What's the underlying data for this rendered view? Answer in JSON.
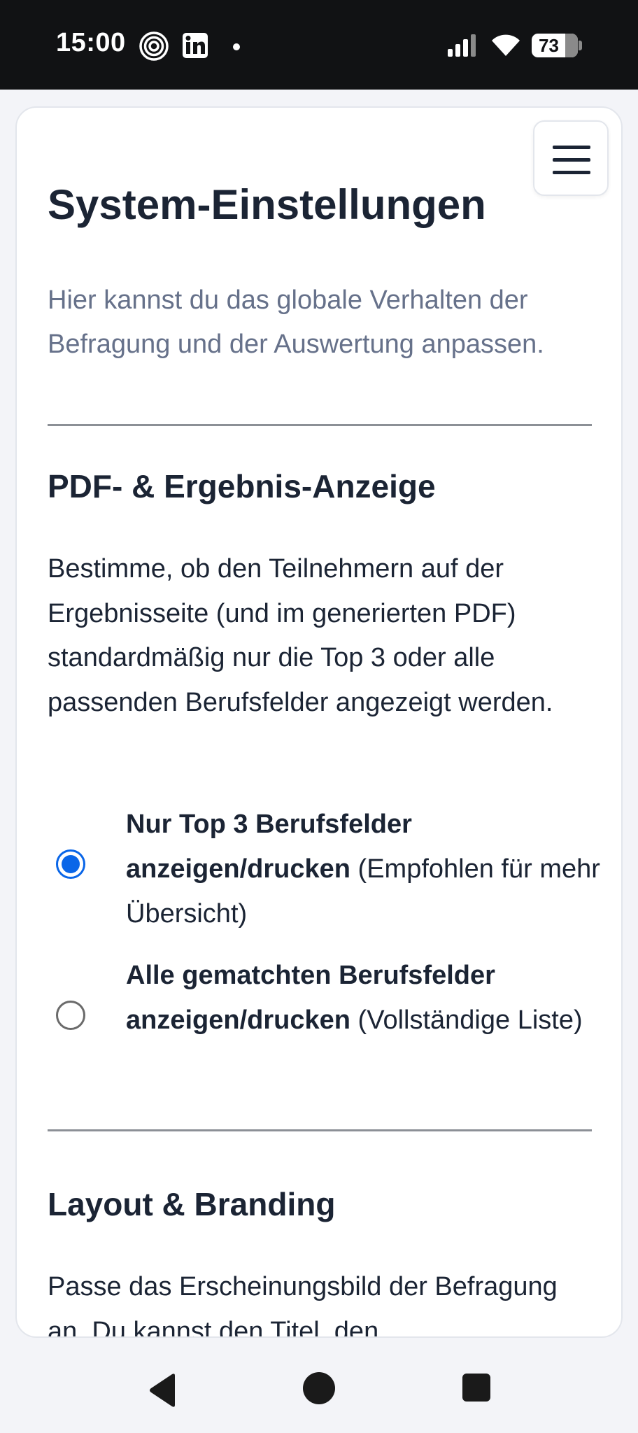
{
  "status_bar": {
    "time": "15:00",
    "battery": "73",
    "icons": [
      "fingerprint-icon",
      "linkedin-icon",
      "dot-icon",
      "signal-icon",
      "wifi-icon",
      "battery-icon"
    ]
  },
  "page": {
    "title": "System-Einstellungen",
    "description": "Hier kannst du das globale Verhalten der Befragung und der Auswertung anpassen."
  },
  "section_pdf": {
    "title": "PDF- & Ergebnis-Anzeige",
    "text": "Bestimme, ob den Teilnehmern auf der Ergebnisseite (und im generierten PDF) standardmäßig nur die Top 3 oder alle passenden Berufsfelder angezeigt werden.",
    "options": [
      {
        "bold": "Nur Top 3 Berufsfelder anzeigen/drucken",
        "note": " (Empfohlen für mehr Übersicht)",
        "checked": true
      },
      {
        "bold": "Alle gematchten Berufsfelder anzeigen/drucken",
        "note": " (Vollständige Liste)",
        "checked": false
      }
    ]
  },
  "section_layout": {
    "title": "Layout & Branding",
    "text": "Passe das Erscheinungsbild der Befragung an. Du kannst den Titel, den"
  },
  "colors": {
    "accent": "#0a66e8",
    "text": "#1b2434",
    "muted": "#66718a",
    "status_bar": "#111214"
  },
  "nav": {
    "icons": [
      "back-icon",
      "home-icon",
      "recents-icon"
    ]
  }
}
